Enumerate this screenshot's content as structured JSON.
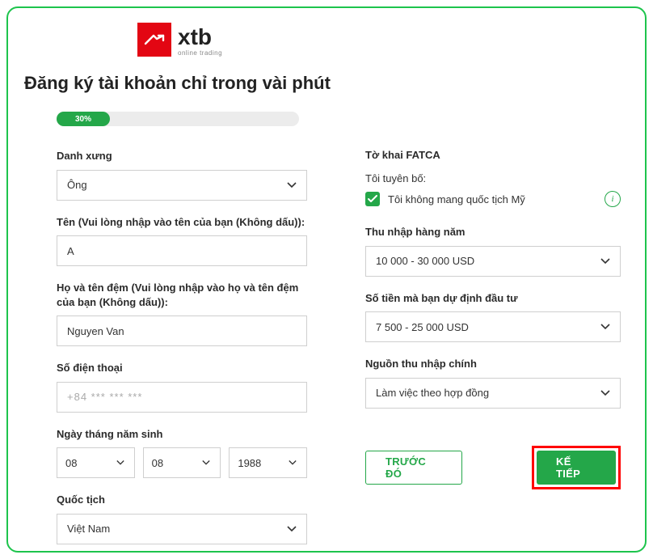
{
  "logo": {
    "brand": "xtb",
    "sub": "online trading"
  },
  "heading": "Đăng ký tài khoản chỉ trong vài phút",
  "progress": {
    "percent": 30,
    "label": "30%"
  },
  "left": {
    "salutation": {
      "label": "Danh xưng",
      "value": "Ông"
    },
    "firstName": {
      "label": "Tên (Vui lòng nhập vào tên của bạn (Không dấu)):",
      "value": "A"
    },
    "lastName": {
      "label": "Họ và tên đệm (Vui lòng nhập vào họ và tên đệm của bạn (Không dấu)):",
      "value": "Nguyen Van"
    },
    "phone": {
      "label": "Số điện thoại",
      "value": "+84 *** *** ***"
    },
    "dob": {
      "label": "Ngày tháng năm sinh",
      "day": "08",
      "month": "08",
      "year": "1988"
    },
    "nationality": {
      "label": "Quốc tịch",
      "value": "Việt Nam"
    }
  },
  "right": {
    "fatca_title": "Tờ khai FATCA",
    "declare": "Tôi tuyên bố:",
    "not_us": "Tôi không mang quốc tịch Mỹ",
    "income": {
      "label": "Thu nhập hàng năm",
      "value": "10 000 - 30 000 USD"
    },
    "invest": {
      "label": "Số tiền mà bạn dự định đầu tư",
      "value": "7 500 - 25 000 USD"
    },
    "source": {
      "label": "Nguồn thu nhập chính",
      "value": "Làm việc theo hợp đồng"
    },
    "prev_btn": "TRƯỚC ĐÓ",
    "next_btn": "KẾ TIẾP"
  }
}
